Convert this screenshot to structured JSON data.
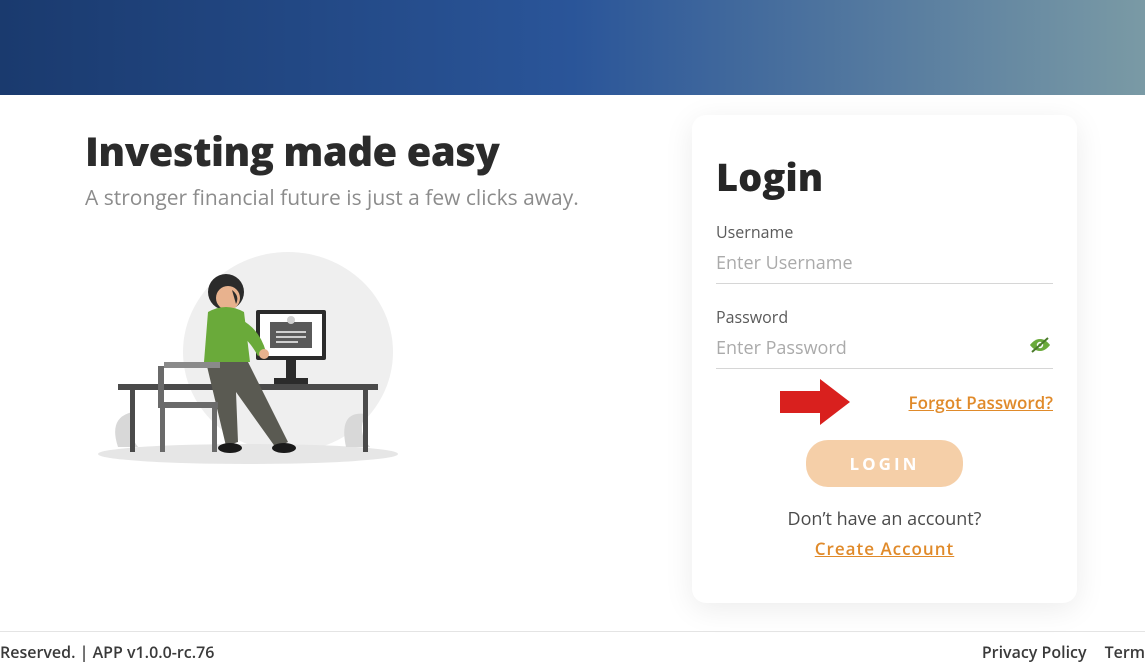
{
  "hero": {
    "title": "Investing made easy",
    "subtitle": "A stronger financial future is just a few clicks away."
  },
  "login": {
    "title": "Login",
    "username_label": "Username",
    "username_placeholder": "Enter Username",
    "password_label": "Password",
    "password_placeholder": "Enter Password",
    "forgot": "Forgot Password?",
    "button": "LOGIN",
    "no_account": "Don’t have an account?",
    "create": "Create Account"
  },
  "footer": {
    "left": "Reserved. | APP v1.0.0-rc.76",
    "privacy": "Privacy Policy",
    "terms": "Term"
  },
  "colors": {
    "accent": "#e08a2a",
    "banner_start": "#1a3a6e",
    "banner_end": "#7a9aa5",
    "login_btn_bg": "#f5cfa8",
    "eye_icon": "#6aaa3a"
  }
}
